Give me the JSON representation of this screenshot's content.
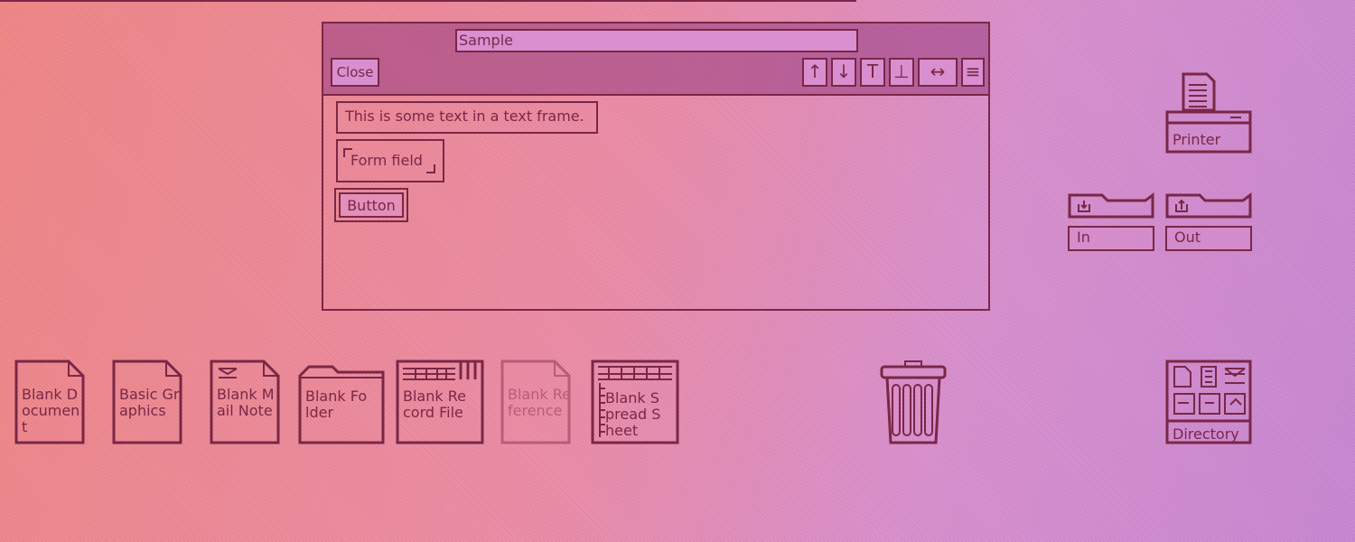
{
  "window": {
    "title": "Sample",
    "close_label": "Close",
    "tools": [
      "↑",
      "↓",
      "T",
      "⊥",
      "↔",
      "≡"
    ]
  },
  "content": {
    "text_frame": "This is some text in a text frame.",
    "form_field": "Form field",
    "button": "Button"
  },
  "desktop": {
    "printer": "Printer",
    "in_tray": "In",
    "out_tray": "Out",
    "directory": "Directory",
    "icons": [
      "Blank Document",
      "Basic Graphics",
      "Blank Mail Note",
      "Blank Folder",
      "Blank Record File",
      "Blank Reference",
      "Blank Spread Sheet"
    ]
  },
  "colors": {
    "ink": "#7a2747",
    "background_left": "#f08a88",
    "background_right": "#c98bd4"
  }
}
